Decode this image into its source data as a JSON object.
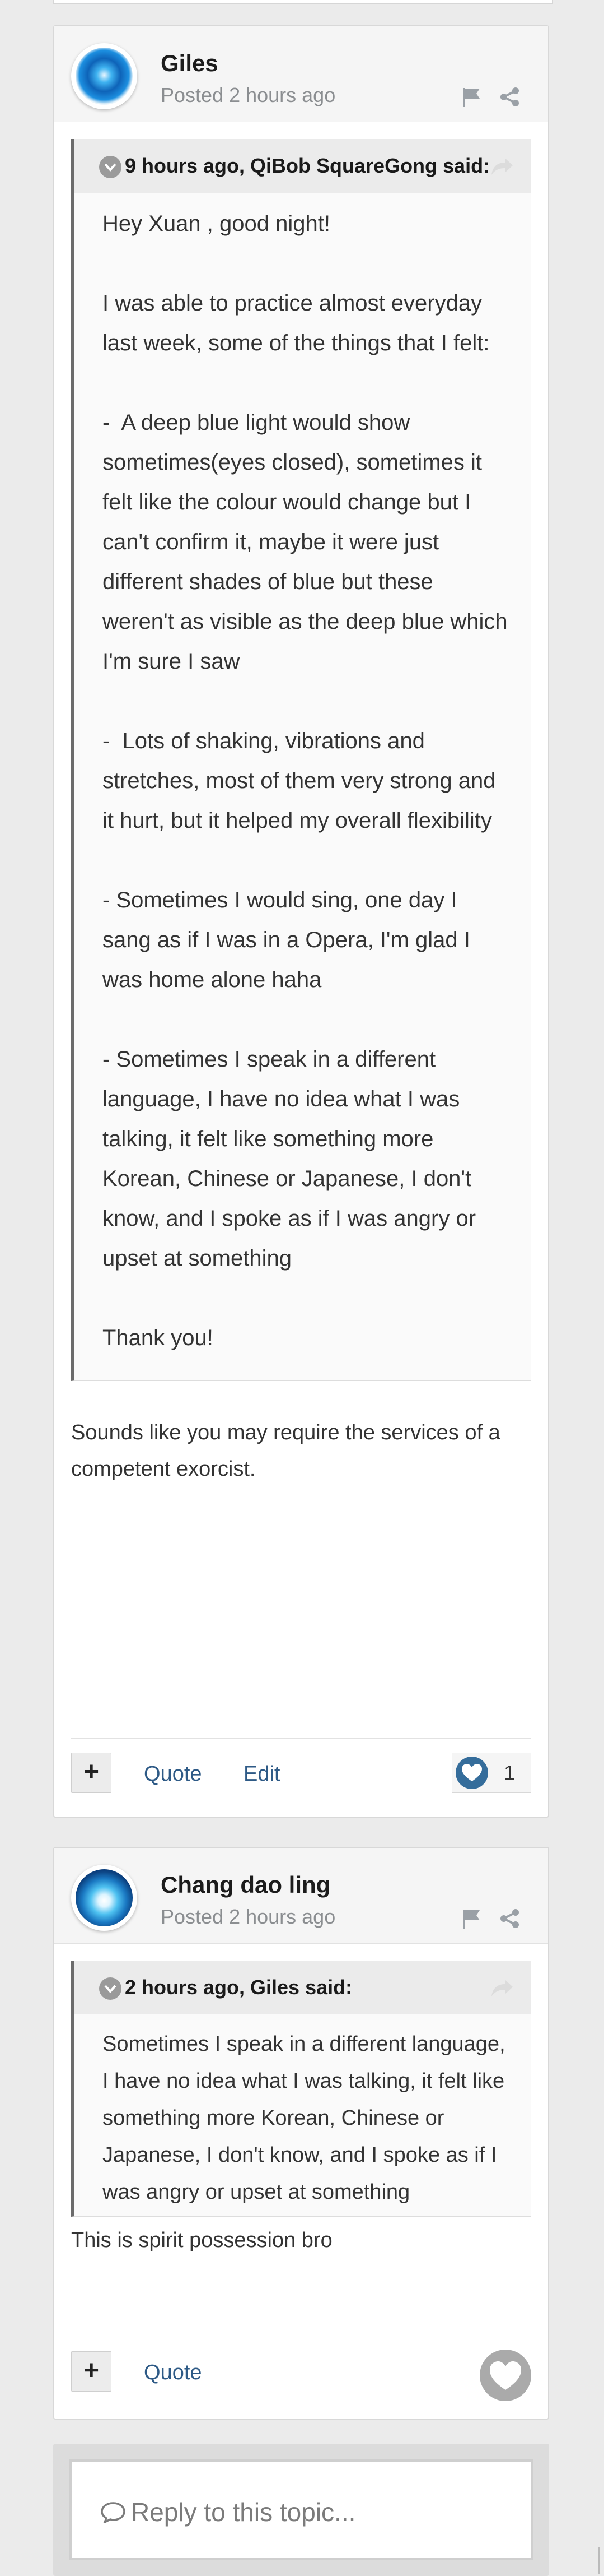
{
  "posts": [
    {
      "author": "Giles",
      "posted": "Posted 2 hours ago",
      "quote": {
        "citation": "9 hours ago, QiBob SquareGong said:",
        "text": "Hey Xuan , good night!\n\nI was able to practice almost everyday last week, some of the things that I felt:\n\n-  A deep blue light would show sometimes(eyes closed), sometimes it felt like the colour would change but I can't confirm it, maybe it were just different shades of blue but these weren't as visible as the deep blue which I'm sure I saw\n\n-  Lots of shaking, vibrations and stretches, most of them very strong and it hurt, but it helped my overall flexibility\n\n- Sometimes I would sing, one day I sang as if I was in a Opera, I'm glad I was home alone haha\n\n- Sometimes I speak in a different language, I have no idea what I was talking, it felt like something more Korean, Chinese or Japanese, I don't know, and I spoke as if I was angry or upset at something\n\nThank you!"
      },
      "text": "Sounds like you may require the services of a competent exorcist.",
      "footer": {
        "plus": "+",
        "quote": "Quote",
        "edit": "Edit",
        "likes": "1"
      }
    },
    {
      "author": "Chang dao ling",
      "posted": "Posted 2 hours ago",
      "quote": {
        "citation": "2 hours ago, Giles said:",
        "text": "Sometimes I speak in a different language, I have no idea what I was talking, it felt like something more Korean, Chinese or Japanese, I don't know, and I spoke as if I was angry or upset at something"
      },
      "text": "This is spirit possession bro",
      "footer": {
        "plus": "+",
        "quote": "Quote"
      }
    }
  ],
  "reply": {
    "placeholder": "Reply to this topic..."
  },
  "icons": {
    "flag": "flag-icon",
    "share": "share-icon",
    "toggle": "chevron-down-icon",
    "quote_share": "share-arrow-icon",
    "like": "heart-icon",
    "reply": "comment-icon"
  },
  "colors": {
    "link": "#2e5a86",
    "like": "#356d9b",
    "quote_border": "#6b6b6b",
    "background": "#ebebeb"
  }
}
